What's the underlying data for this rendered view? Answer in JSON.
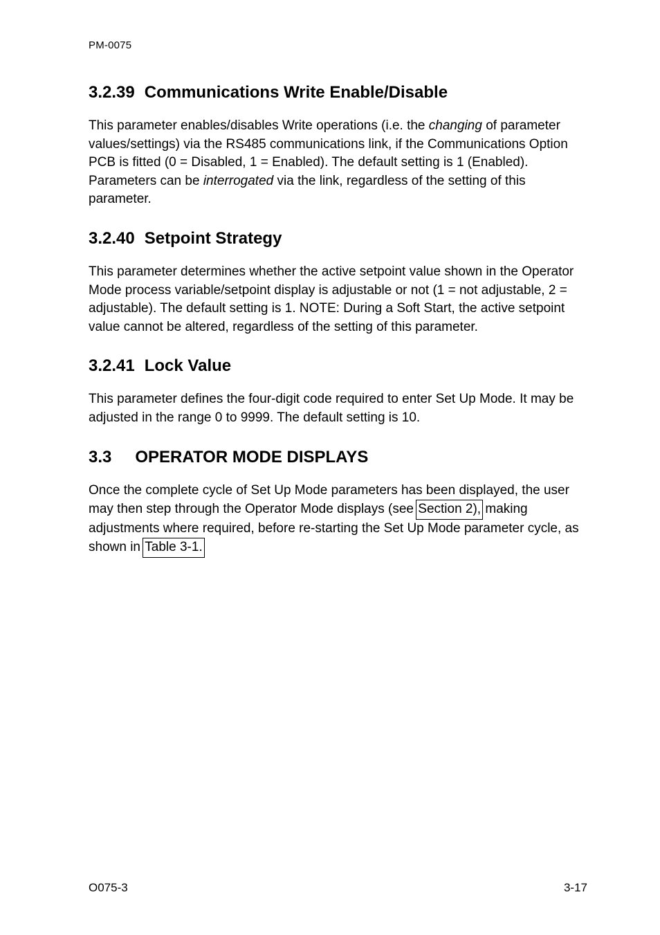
{
  "header": {
    "doc_id": "PM-0075"
  },
  "sections": [
    {
      "number": "3.2.39",
      "title": "Communications Write Enable/Disable",
      "body_html": "This parameter enables/disables Write operations (i.e. the <em>changing</em> of parameter values/settings) via the RS485 communications link, if the Communications Option PCB is fitted (0 = Disabled, 1 = Enabled). The default setting is 1 (Enabled). Parameters can be <em>interrogated</em> via the link, regardless of the setting of this parameter."
    },
    {
      "number": "3.2.40",
      "title": "Setpoint Strategy",
      "body_html": "This parameter determines whether the active setpoint value shown in the Operator Mode process variable/setpoint display is adjustable or not (1 = not adjustable, 2 = adjustable). The default setting is 1. NOTE: During a Soft Start, the active setpoint value cannot be altered, regardless of the setting of this parameter."
    },
    {
      "number": "3.2.41",
      "title": "Lock Value",
      "body_html": "This parameter defines the four-digit code required to enter Set Up Mode. It may be adjusted in the range 0 to 9999. The default setting is 10."
    },
    {
      "number": "3.3",
      "title": "OPERATOR MODE DISPLAYS",
      "body_html": "Once the complete cycle of Set Up Mode parameters has been displayed, the user may then step through the Operator Mode displays (see <span class=\"link-box\">Section 2),</span> making adjustments where required, before re-starting the Set Up Mode parameter cycle, as shown in <span class=\"link-box\">Table 3-1.</span>",
      "big_gap": true
    }
  ],
  "footer": {
    "left": "O075-3",
    "right": "3-17"
  }
}
